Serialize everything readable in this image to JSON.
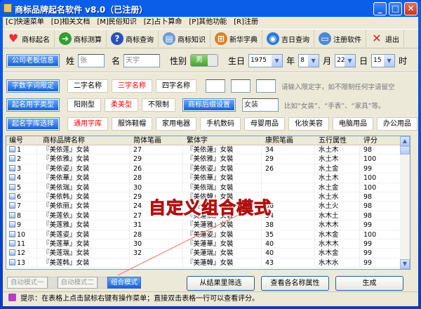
{
  "window": {
    "title": "商标品牌起名软件 v8.0（已注册）",
    "minimize": "_",
    "maximize": "□",
    "close": "✕"
  },
  "menu": [
    "[C]快速菜单",
    "[D]相关文档",
    "[M]民俗知识",
    "[Z]占卜算命",
    "[P]其他功能",
    "[R]注册"
  ],
  "toolbar": [
    {
      "label": "商标起名",
      "icon": "heart-icon",
      "color": "#e83040"
    },
    {
      "label": "商标测算",
      "icon": "arrow-right-icon",
      "color": "#30a030"
    },
    {
      "label": "商标查询",
      "icon": "help-icon",
      "color": "#2a50c8"
    },
    {
      "label": "商标知识",
      "icon": "document-icon",
      "color": "#6a9ad8"
    },
    {
      "label": "新华字典",
      "icon": "windows-icon",
      "color": "#e08020"
    },
    {
      "label": "吉日查询",
      "icon": "globe-icon",
      "color": "#2a7ae0"
    },
    {
      "label": "注册软件",
      "icon": "computer-icon",
      "color": "#4a88d8"
    },
    {
      "label": "退出",
      "icon": "close-icon",
      "color": "#e02020"
    }
  ],
  "info": {
    "button": "公司老板信息",
    "surname_label": "姓",
    "surname": "张",
    "name_label": "名",
    "name": "天宇",
    "gender_label": "性别",
    "gender": "男",
    "birth_label": "生日",
    "year": "1975",
    "year_unit": "年",
    "month": "8",
    "month_unit": "月",
    "day": "22",
    "day_unit": "日",
    "hour": "15",
    "hour_unit": "时"
  },
  "length": {
    "button": "字数字词限定",
    "options": [
      "二字名称",
      "三字名称",
      "四字名称"
    ],
    "selected": 1,
    "hint": "请输入限定字，如不限制任何字请留空"
  },
  "style": {
    "button": "起名用字类型",
    "options": [
      "阳刚型",
      "柔美型",
      "不限制"
    ],
    "selected": 1,
    "suffix_button": "商标后缀设置",
    "suffix": "女装",
    "suffix_hint": "比如“女装”、“手表”、“家具”等。"
  },
  "library": {
    "button": "起名字库选择",
    "options": [
      "通用字库",
      "服饰鞋帽",
      "家用电器",
      "手机数码",
      "母婴用品",
      "化妆美容",
      "电脑用品",
      "办公用品"
    ],
    "selected": 0,
    "next_icon": "next-arrow-icon"
  },
  "table": {
    "headers": [
      "编号",
      "商标品牌名称",
      "简体笔画",
      "繁体字",
      "康熙笔画",
      "五行属性",
      "评分"
    ],
    "rows": [
      [
        "1",
        "『美依莲』女装",
        "27",
        "『美依蓮』女裝",
        "34",
        "水土木",
        "98"
      ],
      [
        "2",
        "『美依雅』女装",
        "29",
        "『美依雅』女裝",
        "29",
        "水土木",
        "100"
      ],
      [
        "3",
        "『美依姿』女装",
        "26",
        "『美依姿』女裝",
        "26",
        "水土金",
        "99"
      ],
      [
        "4",
        "『美依華』女装",
        "28",
        "『美依華』女裝",
        "",
        "水土木",
        "100"
      ],
      [
        "5",
        "『美依瑞』女装",
        "30",
        "『美依瑞』女裝",
        "",
        "水土金",
        "100"
      ],
      [
        "6",
        "『美依韩』女装",
        "29",
        "『美依韓』女裝",
        "",
        "水土水",
        "98"
      ],
      [
        "7",
        "『美依丽』女装",
        "24",
        "『美依麗』女裝",
        "36",
        "水土火",
        "98"
      ],
      [
        "8",
        "『美莲依』女装",
        "27",
        "『美蓮依』女裝",
        "34",
        "水木土",
        "98"
      ],
      [
        "9",
        "『美莲雅』女装",
        "31",
        "『美蓮雅』女裝",
        "38",
        "水木木",
        "99"
      ],
      [
        "10",
        "『美莲姿』女装",
        "28",
        "『美蓮姿』女裝",
        "35",
        "水木金",
        "100"
      ],
      [
        "11",
        "『美莲華』女装",
        "30",
        "『美蓮華』女裝",
        "40",
        "水木木",
        "99"
      ],
      [
        "12",
        "『美莲瑞』女装",
        "32",
        "『美蓮瑞』女裝",
        "40",
        "水木金",
        "99"
      ],
      [
        "13",
        "『美莲韩』女装",
        "",
        "『美蓮韓』女裝",
        "43",
        "水木水",
        "99"
      ]
    ]
  },
  "overlay": "自定义组合模式",
  "modes": [
    "自动模式一",
    "自动模式二",
    "组合模式"
  ],
  "mode_selected": 2,
  "actions": [
    "从结果里筛选",
    "查看各名称属性",
    "生成"
  ],
  "status": "提示：在表格上点击鼠标右键有操作菜单；直接双击表格一行可以查看评分。"
}
